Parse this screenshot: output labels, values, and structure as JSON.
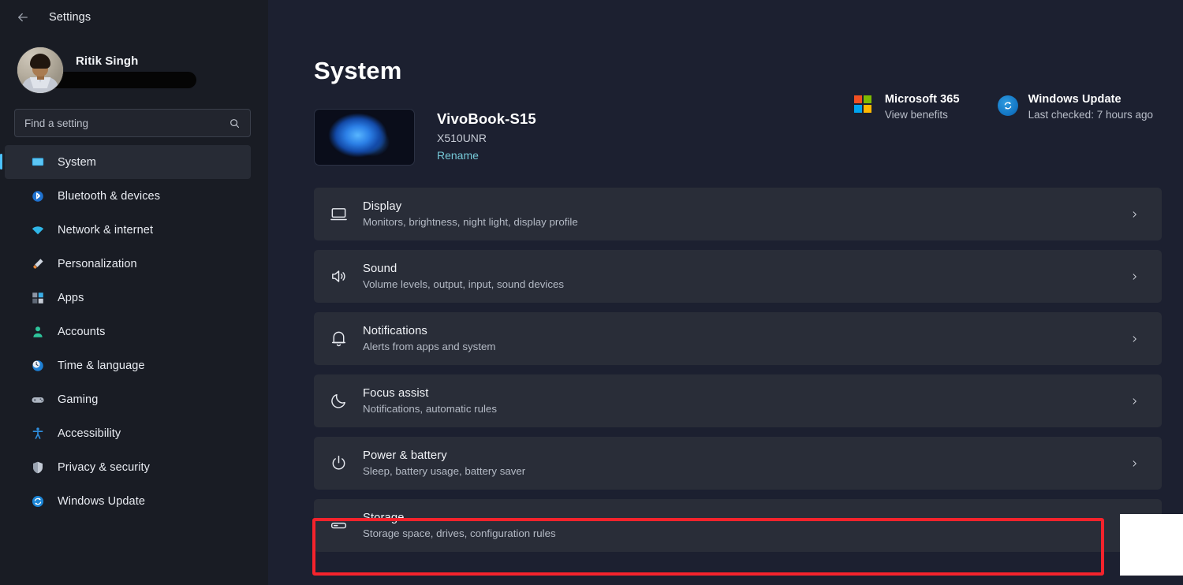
{
  "window": {
    "app_title": "Settings",
    "back_icon": "back-arrow-icon"
  },
  "account": {
    "name": "Ritik Singh",
    "email_redacted": true
  },
  "search": {
    "placeholder": "Find a setting",
    "value": "",
    "icon": "search-icon"
  },
  "sidebar": {
    "items": [
      {
        "label": "System",
        "icon": "monitor-icon",
        "active": true
      },
      {
        "label": "Bluetooth & devices",
        "icon": "bluetooth-icon",
        "active": false
      },
      {
        "label": "Network & internet",
        "icon": "wifi-icon",
        "active": false
      },
      {
        "label": "Personalization",
        "icon": "paintbrush-icon",
        "active": false
      },
      {
        "label": "Apps",
        "icon": "apps-grid-icon",
        "active": false
      },
      {
        "label": "Accounts",
        "icon": "person-icon",
        "active": false
      },
      {
        "label": "Time & language",
        "icon": "clock-globe-icon",
        "active": false
      },
      {
        "label": "Gaming",
        "icon": "gamepad-icon",
        "active": false
      },
      {
        "label": "Accessibility",
        "icon": "accessibility-icon",
        "active": false
      },
      {
        "label": "Privacy & security",
        "icon": "shield-icon",
        "active": false
      },
      {
        "label": "Windows Update",
        "icon": "sync-icon",
        "active": false
      }
    ]
  },
  "main": {
    "page_title": "System",
    "device": {
      "name": "VivoBook-S15",
      "model": "X510UNR",
      "rename_link": "Rename",
      "thumbnail_icon": "windows-bloom-wallpaper"
    },
    "widgets": [
      {
        "title": "Microsoft 365",
        "subtitle": "View benefits",
        "icon": "microsoft-logo-icon"
      },
      {
        "title": "Windows Update",
        "subtitle": "Last checked: 7 hours ago",
        "icon": "sync-icon"
      }
    ],
    "settings_rows": [
      {
        "title": "Display",
        "subtitle": "Monitors, brightness, night light, display profile",
        "icon": "monitor-icon",
        "highlighted": false
      },
      {
        "title": "Sound",
        "subtitle": "Volume levels, output, input, sound devices",
        "icon": "speaker-icon",
        "highlighted": false
      },
      {
        "title": "Notifications",
        "subtitle": "Alerts from apps and system",
        "icon": "bell-icon",
        "highlighted": false
      },
      {
        "title": "Focus assist",
        "subtitle": "Notifications, automatic rules",
        "icon": "moon-icon",
        "highlighted": false
      },
      {
        "title": "Power & battery",
        "subtitle": "Sleep, battery usage, battery saver",
        "icon": "power-icon",
        "highlighted": false
      },
      {
        "title": "Storage",
        "subtitle": "Storage space, drives, configuration rules",
        "icon": "drive-icon",
        "highlighted": true
      }
    ]
  },
  "colors": {
    "accent_blue": "#4cc2ff",
    "highlight_red": "#f4232c",
    "link_teal": "#76c9d8",
    "sidebar_bg": "#191c24",
    "main_bg": "#1c2030",
    "row_bg": "#292d38",
    "ms_red": "#f25022",
    "ms_green": "#7fba00",
    "ms_blue": "#00a4ef",
    "ms_yellow": "#ffb900"
  }
}
